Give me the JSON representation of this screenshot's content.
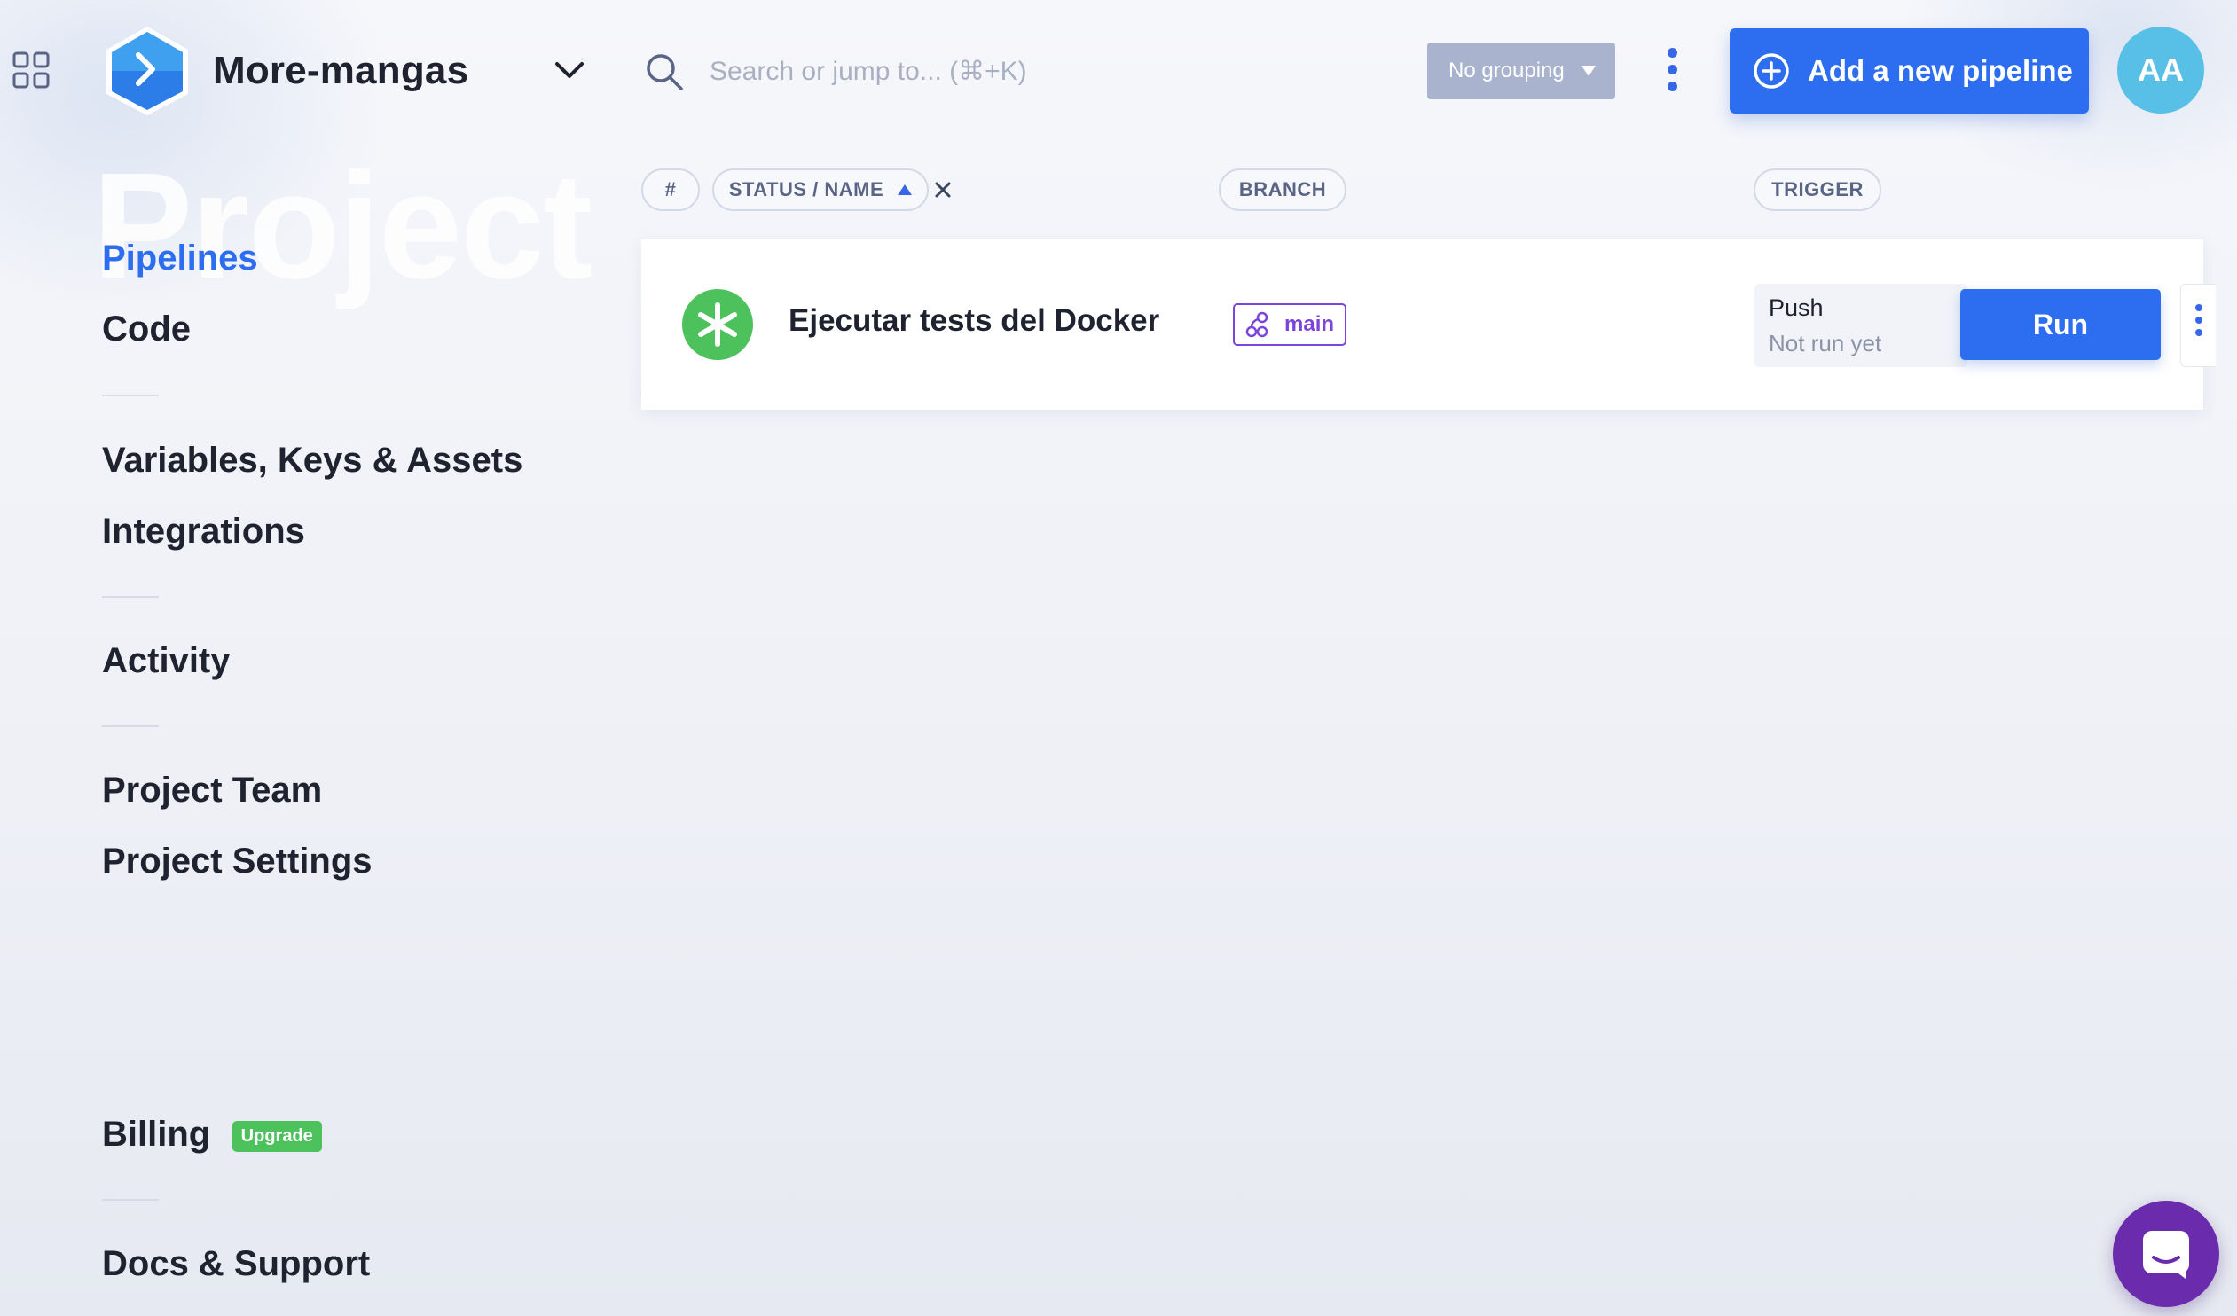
{
  "header": {
    "project_name": "More-mangas",
    "search_placeholder": "Search or jump to... (⌘+K)",
    "grouping_label": "No grouping",
    "add_pipeline_label": "Add a new pipeline",
    "avatar_initials": "AA"
  },
  "sidebar": {
    "watermark": "Project",
    "items": [
      {
        "label": "Pipelines",
        "active": true
      },
      {
        "label": "Code"
      },
      {
        "label": "Variables, Keys & Assets"
      },
      {
        "label": "Integrations"
      },
      {
        "label": "Activity"
      },
      {
        "label": "Project Team"
      },
      {
        "label": "Project Settings"
      },
      {
        "label": "Billing",
        "badge": "Upgrade"
      },
      {
        "label": "Docs & Support"
      }
    ]
  },
  "columns": {
    "number": "#",
    "status_name": "STATUS / NAME",
    "branch": "BRANCH",
    "trigger": "TRIGGER"
  },
  "pipelines": [
    {
      "name": "Ejecutar tests del Docker",
      "branch": "main",
      "trigger": "Push",
      "last_run": "Not run yet",
      "action": "Run"
    }
  ],
  "colors": {
    "accent": "#2d6df0",
    "status_ok": "#4cc15c",
    "branch": "#7a45d8",
    "chat": "#6a2bad",
    "avatar": "#58bfe6"
  },
  "icons": [
    "apps-grid-icon",
    "project-logo-icon",
    "chevron-down-icon",
    "search-icon",
    "caret-down-icon",
    "kebab-icon",
    "plus-circle-icon",
    "sort-up-icon",
    "close-icon",
    "status-pending-icon",
    "branch-icon",
    "chat-icon"
  ]
}
